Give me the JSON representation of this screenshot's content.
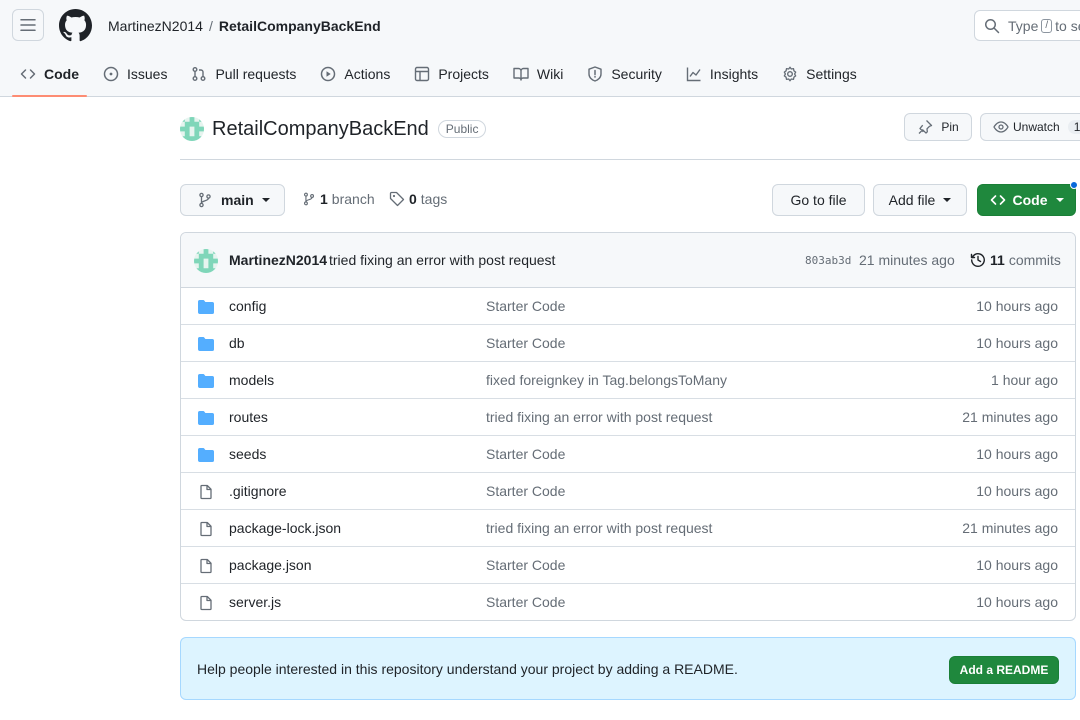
{
  "header": {
    "owner": "MartinezN2014",
    "separator": "/",
    "repo": "RetailCompanyBackEnd",
    "search_prefix": "Type",
    "search_key": "/",
    "search_suffix": "to search"
  },
  "tabs": [
    {
      "label": "Code",
      "icon": "code-icon",
      "active": true
    },
    {
      "label": "Issues",
      "icon": "issue-opened-icon"
    },
    {
      "label": "Pull requests",
      "icon": "git-pull-request-icon"
    },
    {
      "label": "Actions",
      "icon": "play-icon"
    },
    {
      "label": "Projects",
      "icon": "table-icon"
    },
    {
      "label": "Wiki",
      "icon": "book-icon"
    },
    {
      "label": "Security",
      "icon": "shield-icon"
    },
    {
      "label": "Insights",
      "icon": "graph-icon"
    },
    {
      "label": "Settings",
      "icon": "gear-icon"
    }
  ],
  "repo": {
    "name": "RetailCompanyBackEnd",
    "visibility": "Public",
    "pin_label": "Pin",
    "unwatch_label": "Unwatch",
    "unwatch_count": "1"
  },
  "branch_bar": {
    "branch": "main",
    "branch_count": "1",
    "branch_word": "branch",
    "tag_count": "0",
    "tag_word": "tags",
    "goto_file": "Go to file",
    "add_file": "Add file",
    "code_label": "Code"
  },
  "commit": {
    "author": "MartinezN2014",
    "message": "tried fixing an error with post request",
    "sha": "803ab3d",
    "time": "21 minutes ago",
    "commit_count": "11",
    "commit_word": "commits"
  },
  "files": [
    {
      "name": "config",
      "type": "dir",
      "message": "Starter Code",
      "time": "10 hours ago"
    },
    {
      "name": "db",
      "type": "dir",
      "message": "Starter Code",
      "time": "10 hours ago"
    },
    {
      "name": "models",
      "type": "dir",
      "message": "fixed foreignkey in Tag.belongsToMany",
      "time": "1 hour ago"
    },
    {
      "name": "routes",
      "type": "dir",
      "message": "tried fixing an error with post request",
      "time": "21 minutes ago"
    },
    {
      "name": "seeds",
      "type": "dir",
      "message": "Starter Code",
      "time": "10 hours ago"
    },
    {
      "name": ".gitignore",
      "type": "file",
      "message": "Starter Code",
      "time": "10 hours ago"
    },
    {
      "name": "package-lock.json",
      "type": "file",
      "message": "tried fixing an error with post request",
      "time": "21 minutes ago"
    },
    {
      "name": "package.json",
      "type": "file",
      "message": "Starter Code",
      "time": "10 hours ago"
    },
    {
      "name": "server.js",
      "type": "file",
      "message": "Starter Code",
      "time": "10 hours ago"
    }
  ],
  "readme": {
    "text": "Help people interested in this repository understand your project by adding a README.",
    "button": "Add a README"
  },
  "colors": {
    "primary_button": "#1f883d",
    "folder": "#54aeff",
    "active_tab_underline": "#fd8c73",
    "banner_bg": "#ddf4ff"
  }
}
